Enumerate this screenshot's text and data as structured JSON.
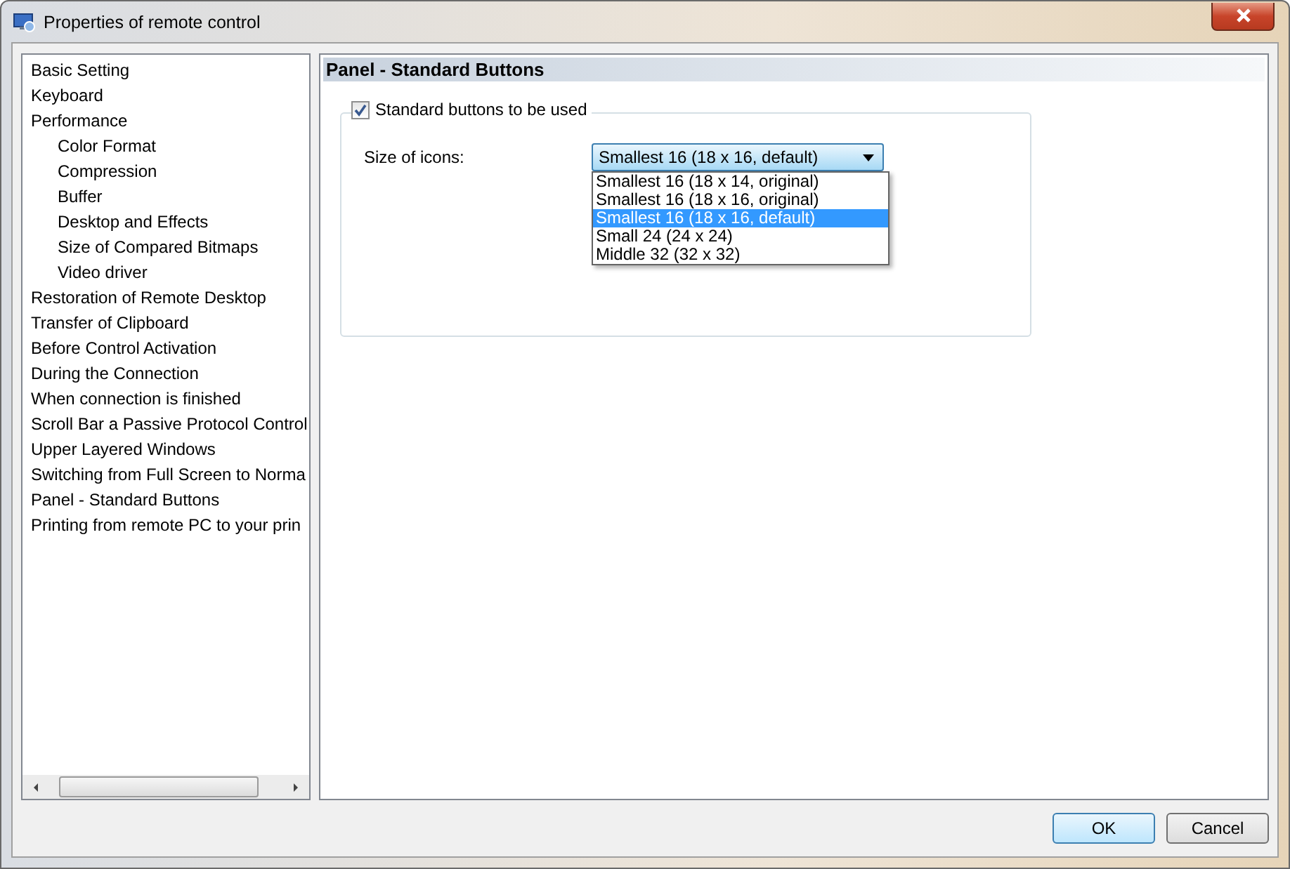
{
  "window": {
    "title": "Properties of remote control"
  },
  "sidebar": {
    "items": [
      {
        "label": "Basic Setting"
      },
      {
        "label": "Keyboard"
      },
      {
        "label": "Performance",
        "children": [
          {
            "label": "Color Format"
          },
          {
            "label": "Compression"
          },
          {
            "label": "Buffer"
          },
          {
            "label": "Desktop and Effects"
          },
          {
            "label": "Size of Compared Bitmaps"
          },
          {
            "label": "Video driver"
          }
        ]
      },
      {
        "label": "Restoration of Remote Desktop"
      },
      {
        "label": "Transfer of Clipboard"
      },
      {
        "label": "Before Control Activation"
      },
      {
        "label": "During the Connection"
      },
      {
        "label": "When connection is finished"
      },
      {
        "label": "Scroll Bar a Passive Protocol Control"
      },
      {
        "label": "Upper Layered Windows"
      },
      {
        "label": "Switching from Full Screen to Norma"
      },
      {
        "label": "Panel - Standard Buttons"
      },
      {
        "label": "Printing from remote PC to your prin"
      }
    ]
  },
  "panel": {
    "title": "Panel - Standard Buttons",
    "checkbox": {
      "label": "Standard buttons to be used",
      "checked": true
    },
    "size_label": "Size of icons:",
    "dropdown": {
      "value": "Smallest 16 (18 x 16, default)",
      "options": [
        {
          "label": "Smallest 16 (18 x 14, original)",
          "selected": false
        },
        {
          "label": "Smallest 16 (18 x 16, original)",
          "selected": false
        },
        {
          "label": "Smallest 16 (18 x 16, default)",
          "selected": true
        },
        {
          "label": "Small 24 (24 x 24)",
          "selected": false
        },
        {
          "label": "Middle 32 (32 x 32)",
          "selected": false
        }
      ]
    }
  },
  "buttons": [
    {
      "label": "OK",
      "kind": "default"
    },
    {
      "label": "Cancel",
      "kind": "normal"
    }
  ]
}
